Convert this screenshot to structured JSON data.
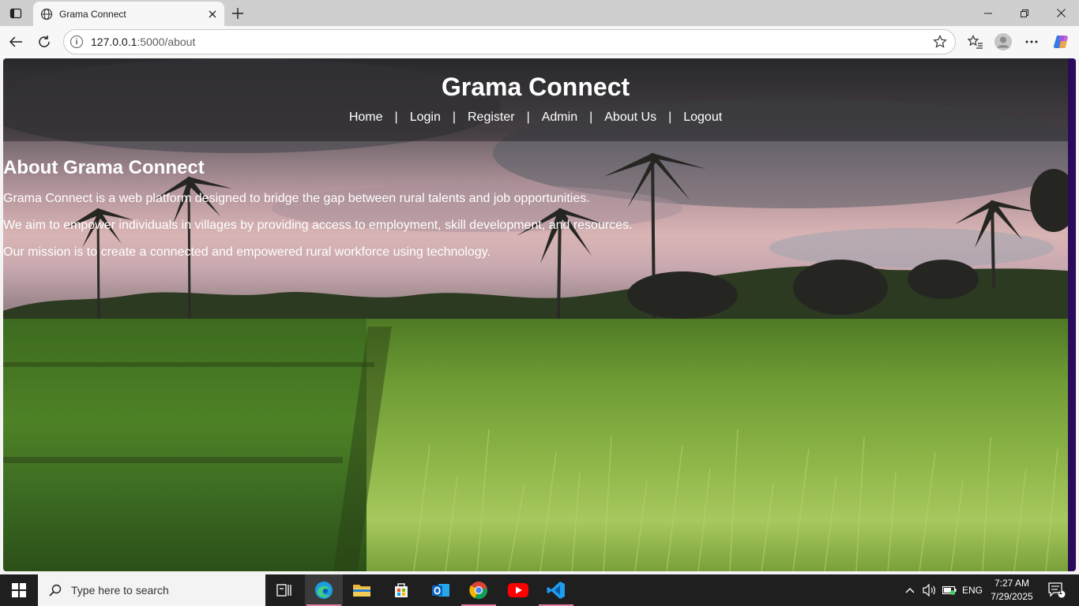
{
  "browser": {
    "tab_title": "Grama Connect",
    "url_host": "127.0.0.1",
    "url_path": ":5000/about"
  },
  "page": {
    "site_title": "Grama Connect",
    "nav": {
      "home": "Home",
      "login": "Login",
      "register": "Register",
      "admin": "Admin",
      "about": "About Us",
      "logout": "Logout",
      "separator": "|"
    },
    "about": {
      "heading": "About Grama Connect",
      "p1": "Grama Connect is a web platform designed to bridge the gap between rural talents and job opportunities.",
      "p2": "We aim to empower individuals in villages by providing access to employment, skill development, and resources.",
      "p3": "Our mission is to create a connected and empowered rural workforce using technology."
    }
  },
  "taskbar": {
    "search_placeholder": "Type here to search",
    "language": "ENG",
    "time": "7:27 AM",
    "date": "7/29/2025",
    "notification_count": "1"
  }
}
